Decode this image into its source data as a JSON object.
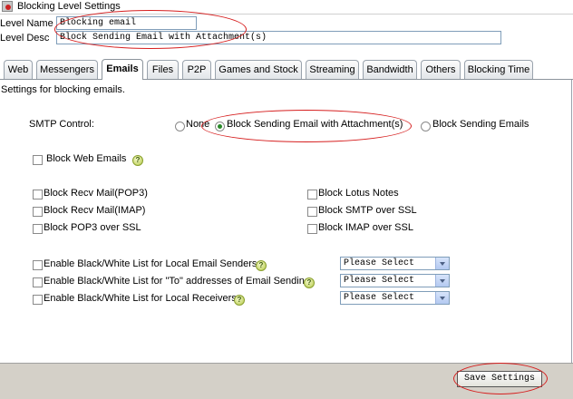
{
  "window": {
    "title": "Blocking Level Settings"
  },
  "level": {
    "name_label": "Level Name",
    "name_value": "Blocking email",
    "desc_label": "Level Desc",
    "desc_value": "Block Sending Email with Attachment(s)"
  },
  "tabs": [
    {
      "label": "Web",
      "active": false
    },
    {
      "label": "Messengers",
      "active": false
    },
    {
      "label": "Emails",
      "active": true
    },
    {
      "label": "Files",
      "active": false
    },
    {
      "label": "P2P",
      "active": false
    },
    {
      "label": "Games and Stock",
      "active": false
    },
    {
      "label": "Streaming",
      "active": false
    },
    {
      "label": "Bandwidth",
      "active": false
    },
    {
      "label": "Others",
      "active": false
    },
    {
      "label": "Blocking Time",
      "active": false
    }
  ],
  "emails": {
    "heading": "Settings for blocking emails.",
    "smtp": {
      "label": "SMTP Control:",
      "options": [
        "None",
        "Block Sending Email with Attachment(s)",
        "Block Sending Emails"
      ],
      "selected": "Block Sending Email with Attachment(s)"
    },
    "block_web_emails": {
      "label": "Block Web Emails",
      "checked": false
    },
    "left_checks": [
      {
        "label": "Block Recv Mail(POP3)",
        "checked": false
      },
      {
        "label": "Block Recv Mail(IMAP)",
        "checked": false
      },
      {
        "label": "Block POP3 over SSL",
        "checked": false
      }
    ],
    "right_checks": [
      {
        "label": "Block Lotus Notes",
        "checked": false
      },
      {
        "label": "Block SMTP over SSL",
        "checked": false
      },
      {
        "label": "Block IMAP over SSL",
        "checked": false
      }
    ],
    "lists": [
      {
        "label": "Enable Black/White List for Local Email Senders",
        "checked": false,
        "select_value": "Please Select",
        "help": true
      },
      {
        "label": "Enable Black/White List for \"To\" addresses of Email Sending",
        "checked": false,
        "select_value": "Please Select",
        "help": true
      },
      {
        "label": "Enable Black/White List for Local Receivers",
        "checked": false,
        "select_value": "Please Select",
        "help": true
      }
    ],
    "help_glyph": "?"
  },
  "footer": {
    "save_label": "Save Settings"
  },
  "colors": {
    "annotation": "#d61f1f",
    "footer_bg": "#d4d0c8",
    "radio_selected": "#2a8a2a"
  },
  "icons": {
    "window": "app-warning-icon",
    "help": "help-icon",
    "select_arrow": "chevron-down-icon"
  }
}
